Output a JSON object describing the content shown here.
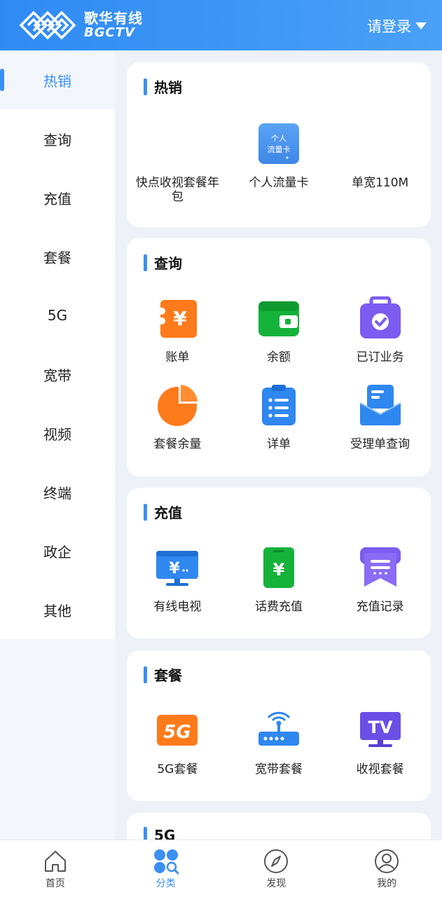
{
  "header": {
    "logo_cn": "歌华有线",
    "logo_en": "BGCTV",
    "login_label": "请登录"
  },
  "sidebar": {
    "items": [
      {
        "label": "热销",
        "active": true
      },
      {
        "label": "查询"
      },
      {
        "label": "充值"
      },
      {
        "label": "套餐"
      },
      {
        "label": "5G"
      },
      {
        "label": "宽带"
      },
      {
        "label": "视频"
      },
      {
        "label": "终端"
      },
      {
        "label": "政企"
      },
      {
        "label": "其他"
      }
    ]
  },
  "sections": {
    "hot": {
      "title": "热销",
      "items": [
        {
          "label": "快点收视套餐年包",
          "icon": "none"
        },
        {
          "label": "个人流量卡",
          "icon": "flow-card-icon",
          "icon_text": "个人流量卡"
        },
        {
          "label": "单宽110M",
          "icon": "none"
        }
      ]
    },
    "query": {
      "title": "查询",
      "items": [
        {
          "label": "账单",
          "icon": "bill-icon"
        },
        {
          "label": "余额",
          "icon": "wallet-icon"
        },
        {
          "label": "已订业务",
          "icon": "subscribed-icon"
        },
        {
          "label": "套餐余量",
          "icon": "pie-chart-icon"
        },
        {
          "label": "详单",
          "icon": "clipboard-list-icon"
        },
        {
          "label": "受理单查询",
          "icon": "inbox-doc-icon"
        }
      ]
    },
    "recharge": {
      "title": "充值",
      "items": [
        {
          "label": "有线电视",
          "icon": "tv-yuan-icon"
        },
        {
          "label": "话费充值",
          "icon": "phone-yuan-icon"
        },
        {
          "label": "充值记录",
          "icon": "record-icon"
        }
      ]
    },
    "package": {
      "title": "套餐",
      "items": [
        {
          "label": "5G套餐",
          "icon": "5g-icon",
          "icon_text": "5G"
        },
        {
          "label": "宽带套餐",
          "icon": "router-icon"
        },
        {
          "label": "收视套餐",
          "icon": "tv-icon",
          "icon_text": "TV"
        }
      ]
    },
    "five_g": {
      "title": "5G"
    }
  },
  "bottom_nav": {
    "items": [
      {
        "label": "首页",
        "icon": "home-icon"
      },
      {
        "label": "分类",
        "icon": "category-icon",
        "active": true
      },
      {
        "label": "发现",
        "icon": "compass-icon"
      },
      {
        "label": "我的",
        "icon": "user-icon"
      }
    ]
  },
  "colors": {
    "primary": "#3a8ff2",
    "header_bg": "#2f8bf3",
    "page_bg": "#eef2f8"
  }
}
